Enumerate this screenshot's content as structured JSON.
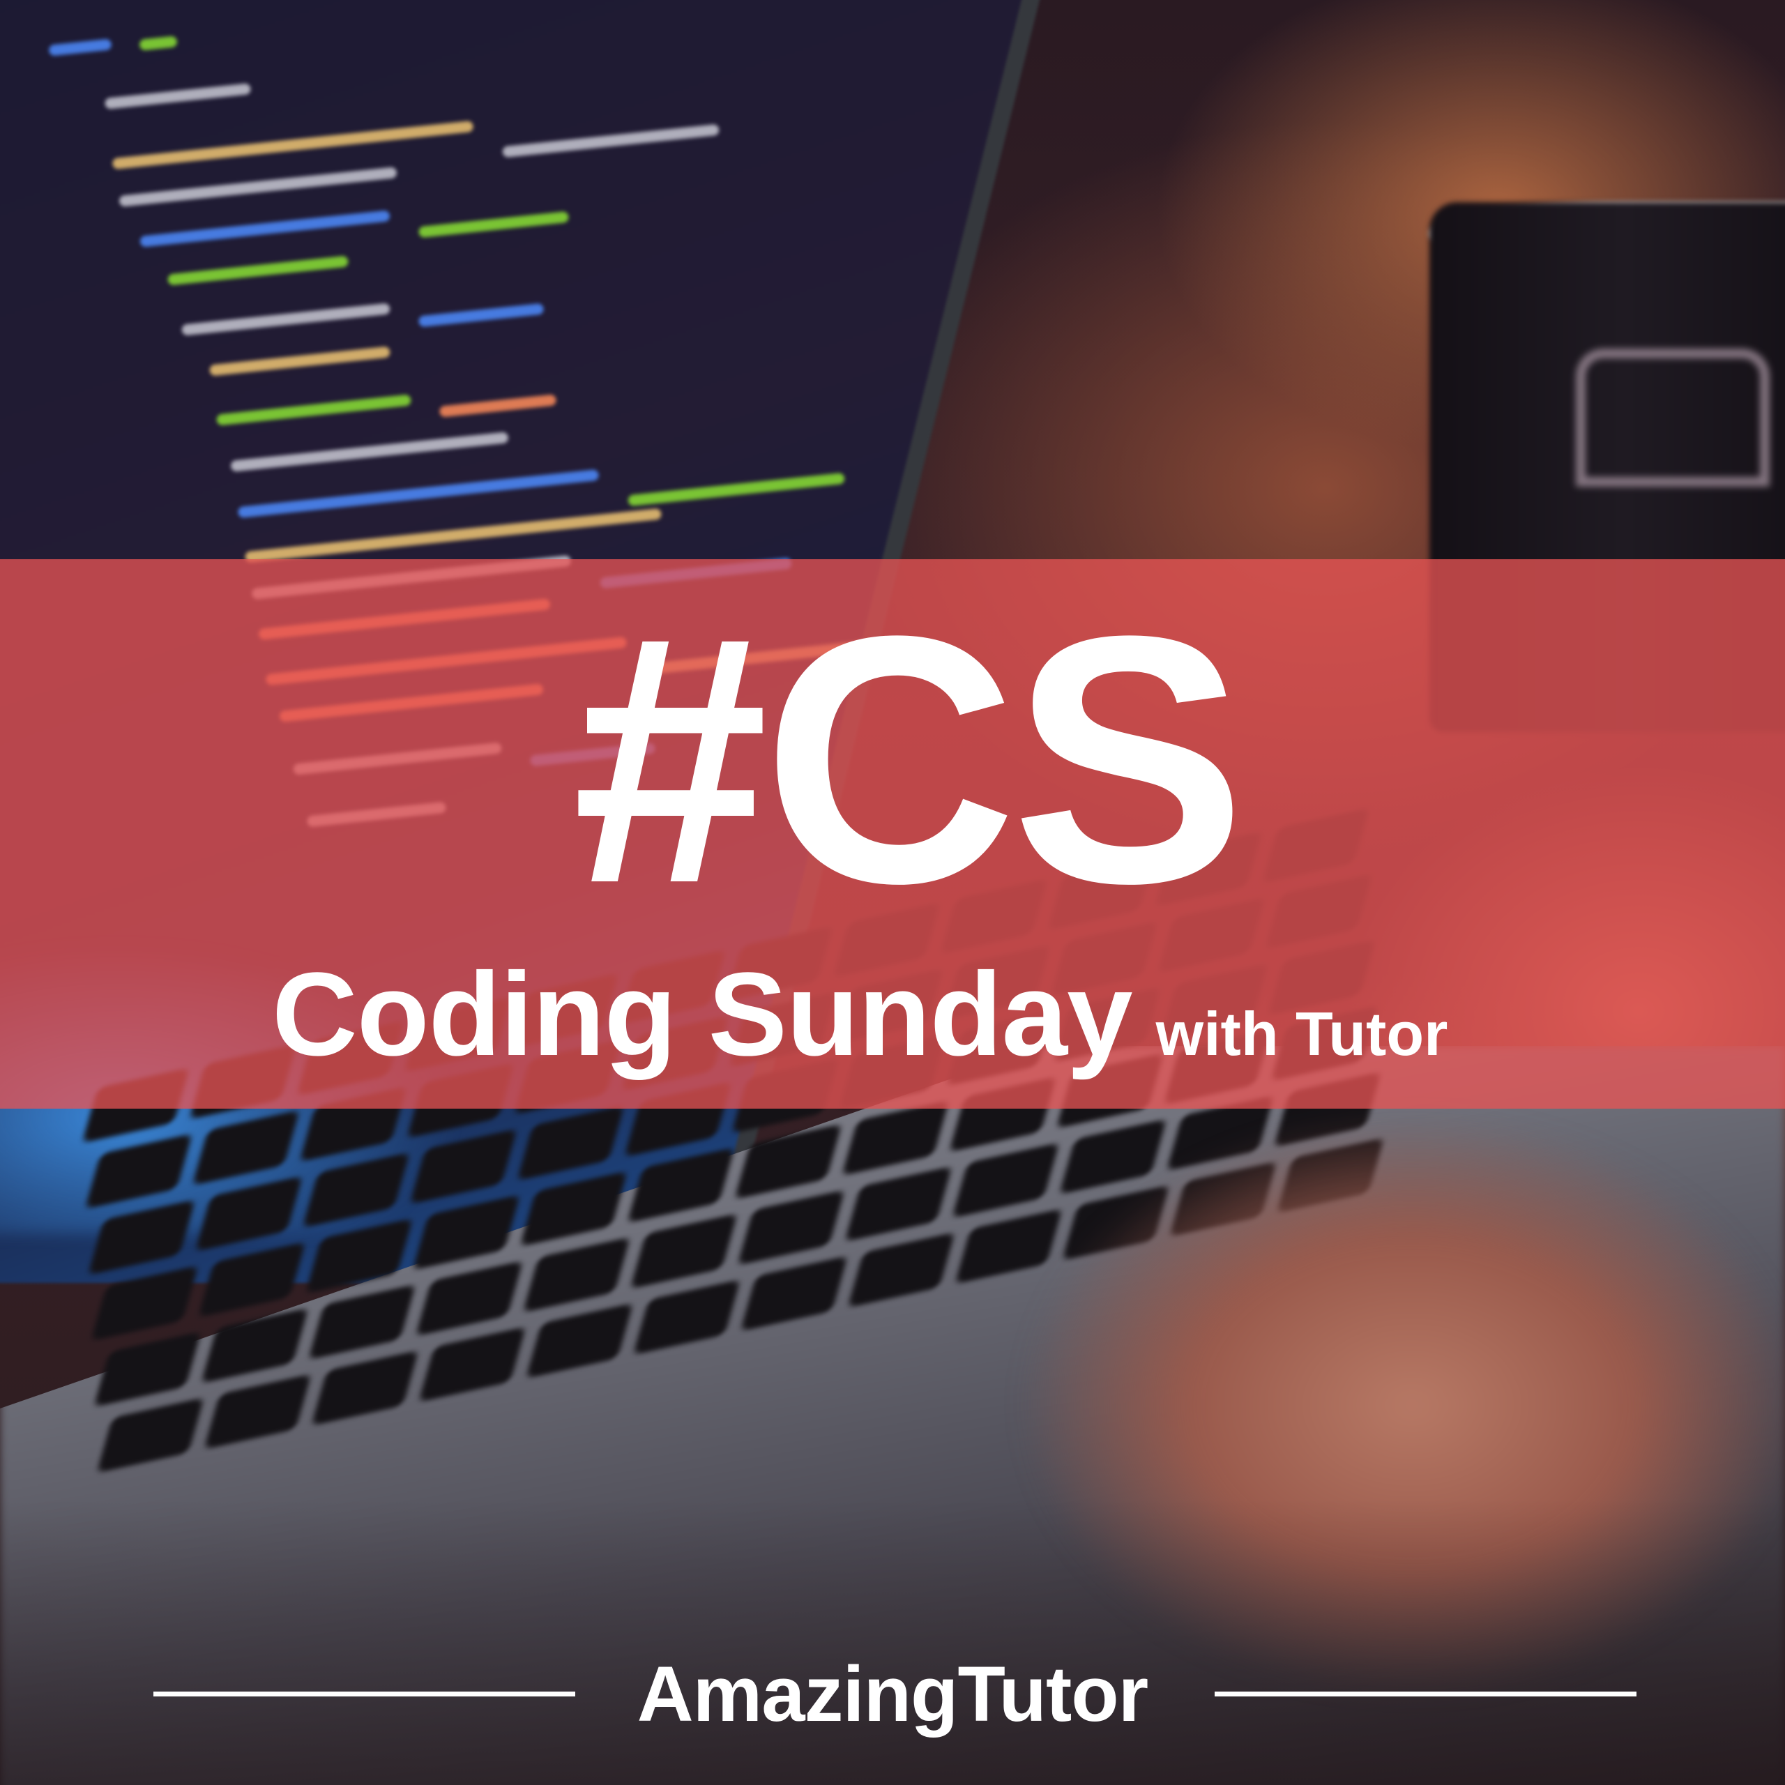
{
  "banner": {
    "hashtag": "#CS",
    "title": "Coding Sunday",
    "title_suffix": "with Tutor",
    "color": "#e85454"
  },
  "footer": {
    "brand": "AmazingTutor"
  },
  "background": {
    "code_colors": [
      "#4e8cff",
      "#f0c674",
      "#8ae234",
      "#c9c9d4",
      "#ff8c5a"
    ]
  }
}
